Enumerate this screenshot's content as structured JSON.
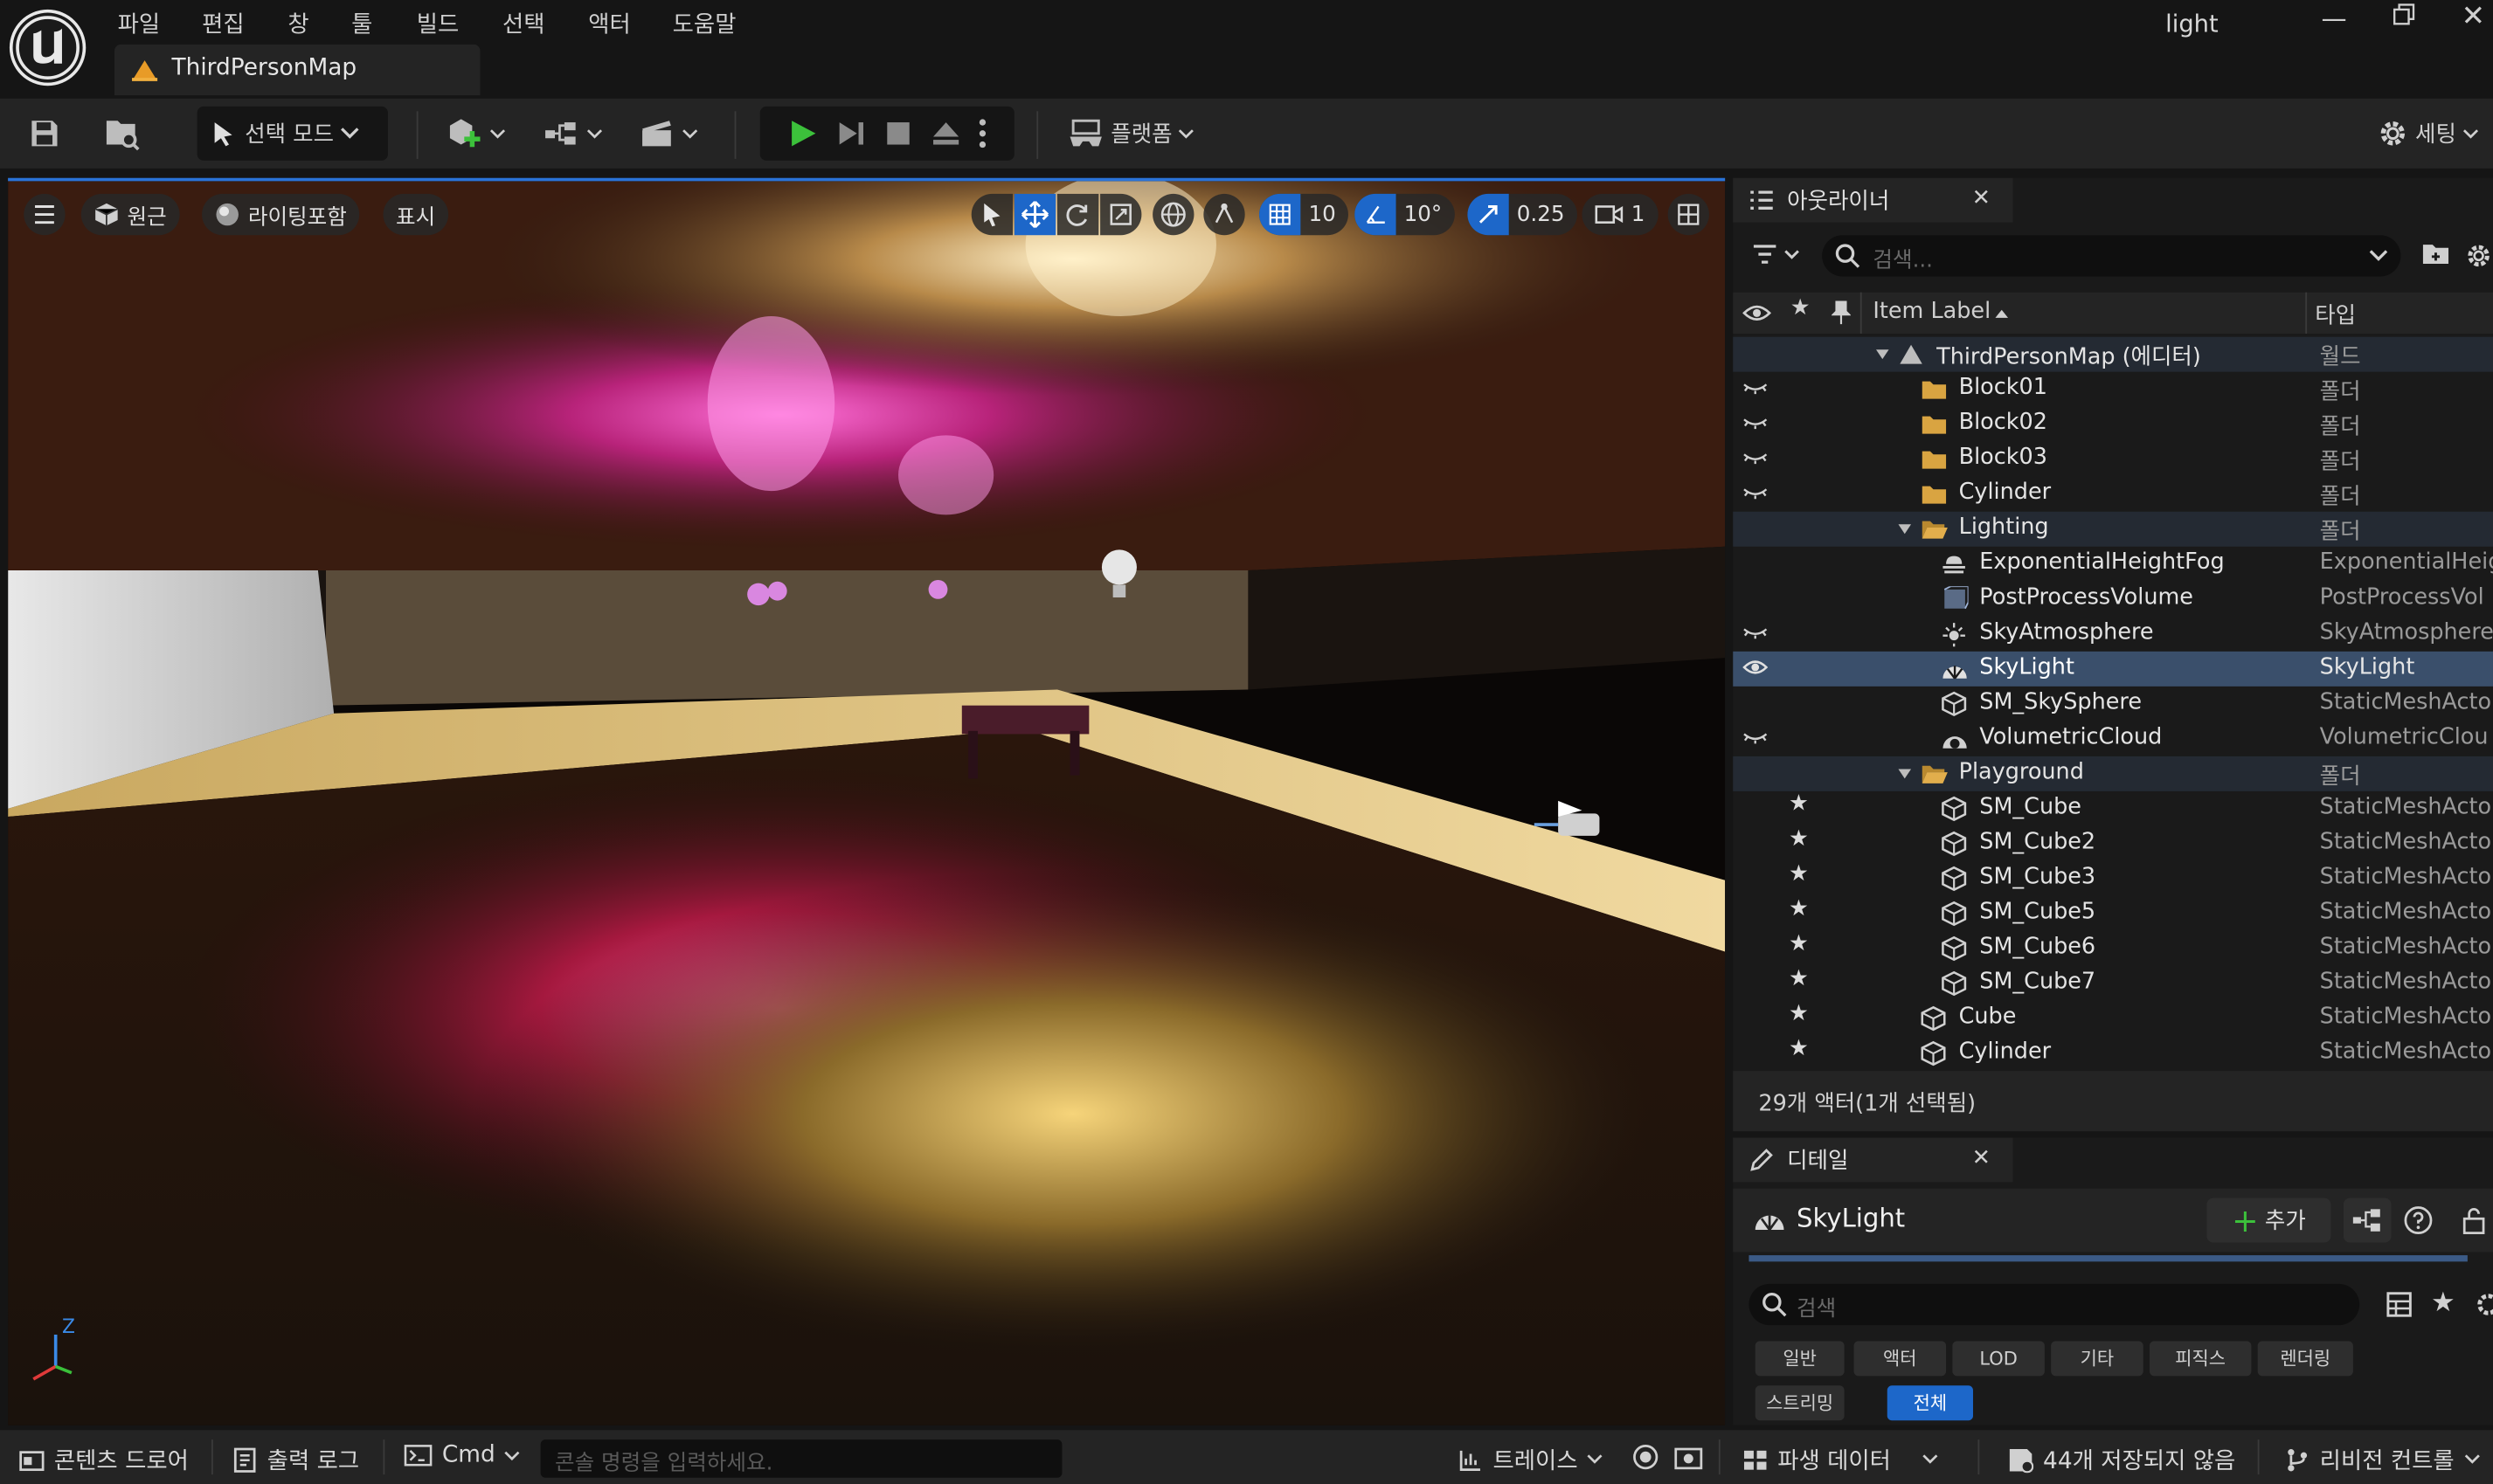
{
  "app": {
    "project_name": "light",
    "document_tab": "ThirdPersonMap"
  },
  "menu": [
    "파일",
    "편집",
    "창",
    "툴",
    "빌드",
    "선택",
    "액터",
    "도움말"
  ],
  "toolbar": {
    "mode_label": "선택 모드",
    "platform_label": "플랫폼",
    "settings_label": "세팅"
  },
  "viewport": {
    "perspective_label": "원근",
    "lighting_label": "라이팅포함",
    "show_label": "표시",
    "grid_snap": "10",
    "rotation_snap": "10°",
    "scale_snap": "0.25",
    "camera_speed": "1",
    "axis_z": "Z"
  },
  "outliner": {
    "tab_label": "아웃라이너",
    "search_placeholder": "검색...",
    "col_label": "Item Label",
    "col_type": "타입",
    "footer": "29개 액터(1개 선택됨)",
    "rows": [
      {
        "label": "ThirdPersonMap (에디터)",
        "type": "월드",
        "indent": 1,
        "icon": "map-icon",
        "eye": false,
        "star": false,
        "expander": true
      },
      {
        "label": "Block01",
        "type": "폴더",
        "indent": 2,
        "icon": "folder-icon",
        "eye": true,
        "star": false
      },
      {
        "label": "Block02",
        "type": "폴더",
        "indent": 2,
        "icon": "folder-icon",
        "eye": true,
        "star": false
      },
      {
        "label": "Block03",
        "type": "폴더",
        "indent": 2,
        "icon": "folder-icon",
        "eye": true,
        "star": false
      },
      {
        "label": "Cylinder",
        "type": "폴더",
        "indent": 2,
        "icon": "folder-icon",
        "eye": true,
        "star": false
      },
      {
        "label": "Lighting",
        "type": "폴더",
        "indent": 2,
        "icon": "folder-open-icon",
        "eye": false,
        "star": false,
        "expander": true
      },
      {
        "label": "ExponentialHeightFog",
        "type": "ExponentialHeig",
        "indent": 3,
        "icon": "fog-icon",
        "eye": false,
        "star": false
      },
      {
        "label": "PostProcessVolume",
        "type": "PostProcessVol",
        "indent": 3,
        "icon": "volume-icon",
        "eye": false,
        "star": false
      },
      {
        "label": "SkyAtmosphere",
        "type": "SkyAtmosphere",
        "indent": 3,
        "icon": "sun-icon",
        "eye": true,
        "star": false
      },
      {
        "label": "SkyLight",
        "type": "SkyLight",
        "indent": 3,
        "icon": "skylight-icon",
        "eye": true,
        "star": false,
        "selected": true
      },
      {
        "label": "SM_SkySphere",
        "type": "StaticMeshActo",
        "indent": 3,
        "icon": "mesh-icon",
        "eye": false,
        "star": false
      },
      {
        "label": "VolumetricCloud",
        "type": "VolumetricClou",
        "indent": 3,
        "icon": "cloud-icon",
        "eye": true,
        "star": false
      },
      {
        "label": "Playground",
        "type": "폴더",
        "indent": 2,
        "icon": "folder-open-icon",
        "eye": false,
        "star": false,
        "expander": true
      },
      {
        "label": "SM_Cube",
        "type": "StaticMeshActo",
        "indent": 3,
        "icon": "mesh-icon",
        "eye": false,
        "star": true
      },
      {
        "label": "SM_Cube2",
        "type": "StaticMeshActo",
        "indent": 3,
        "icon": "mesh-icon",
        "eye": false,
        "star": true
      },
      {
        "label": "SM_Cube3",
        "type": "StaticMeshActo",
        "indent": 3,
        "icon": "mesh-icon",
        "eye": false,
        "star": true
      },
      {
        "label": "SM_Cube5",
        "type": "StaticMeshActo",
        "indent": 3,
        "icon": "mesh-icon",
        "eye": false,
        "star": true
      },
      {
        "label": "SM_Cube6",
        "type": "StaticMeshActo",
        "indent": 3,
        "icon": "mesh-icon",
        "eye": false,
        "star": true
      },
      {
        "label": "SM_Cube7",
        "type": "StaticMeshActo",
        "indent": 3,
        "icon": "mesh-icon",
        "eye": false,
        "star": true
      },
      {
        "label": "Cube",
        "type": "StaticMeshActo",
        "indent": 2,
        "icon": "mesh-icon",
        "eye": false,
        "star": true
      },
      {
        "label": "Cylinder",
        "type": "StaticMeshActo",
        "indent": 2,
        "icon": "mesh-icon",
        "eye": false,
        "star": true
      }
    ]
  },
  "details": {
    "tab_label": "디테일",
    "object_name": "SkyLight",
    "add_label": "추가",
    "search_placeholder": "검색",
    "filters": [
      "일반",
      "액터",
      "LOD",
      "기타",
      "피직스",
      "렌더링",
      "스트리밍",
      "전체"
    ],
    "active_filter": "전체"
  },
  "statusbar": {
    "content_drawer": "콘텐츠 드로어",
    "output_log": "출력 로그",
    "cmd": "Cmd",
    "console_placeholder": "콘솔 명령을 입력하세요.",
    "trace": "트레이스",
    "derived_data": "파생 데이터",
    "unsaved": "44개 저장되지 않음",
    "revision": "리비전 컨트롤"
  },
  "colors": {
    "accent": "#1d67c9",
    "selected_row": "#3a4f6b",
    "play_green": "#3cc13b"
  }
}
